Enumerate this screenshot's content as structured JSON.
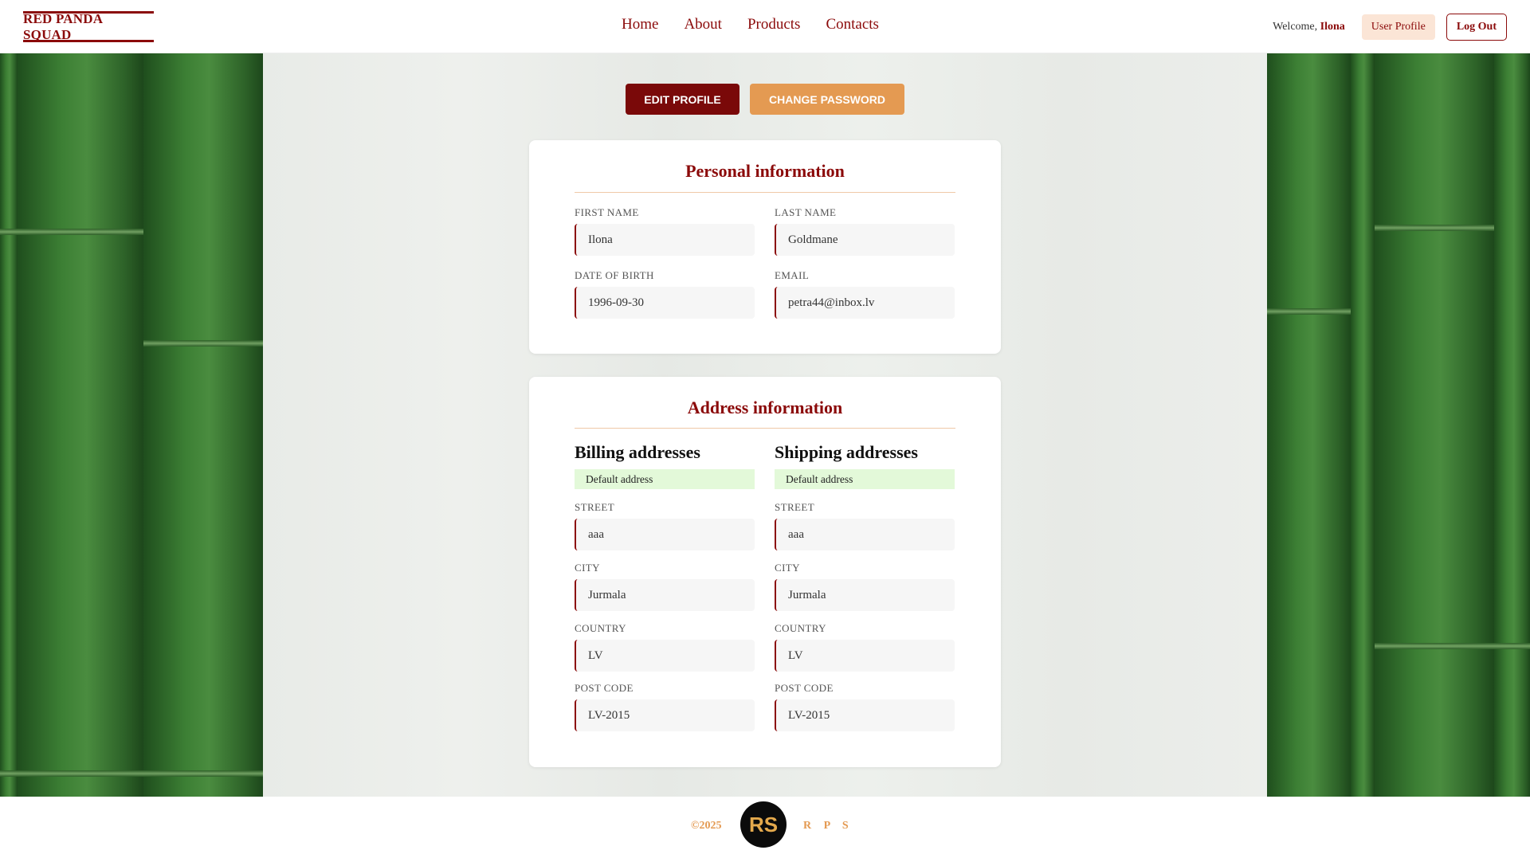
{
  "header": {
    "logo": "RED PANDA SQUAD",
    "nav": [
      "Home",
      "About",
      "Products",
      "Contacts"
    ],
    "welcome_prefix": "Welcome,",
    "user_name": "Ilona",
    "profile_label": "User Profile",
    "logout_label": "Log Out"
  },
  "actions": {
    "edit_label": "EDIT PROFILE",
    "password_label": "CHANGE PASSWORD"
  },
  "personal": {
    "title": "Personal information",
    "first_name": {
      "label": "FIRST NAME",
      "value": "Ilona"
    },
    "last_name": {
      "label": "LAST NAME",
      "value": "Goldmane"
    },
    "dob": {
      "label": "DATE OF BIRTH",
      "value": "1996-09-30"
    },
    "email": {
      "label": "EMAIL",
      "value": "petra44@inbox.lv"
    }
  },
  "address": {
    "title": "Address information",
    "billing": {
      "title": "Billing addresses",
      "badge": "Default address",
      "street": {
        "label": "STREET",
        "value": "aaa"
      },
      "city": {
        "label": "CITY",
        "value": "Jurmala"
      },
      "country": {
        "label": "COUNTRY",
        "value": "LV"
      },
      "post_code": {
        "label": "POST CODE",
        "value": "LV-2015"
      }
    },
    "shipping": {
      "title": "Shipping addresses",
      "badge": "Default address",
      "street": {
        "label": "STREET",
        "value": "aaa"
      },
      "city": {
        "label": "CITY",
        "value": "Jurmala"
      },
      "country": {
        "label": "COUNTRY",
        "value": "LV"
      },
      "post_code": {
        "label": "POST CODE",
        "value": "LV-2015"
      }
    }
  },
  "footer": {
    "copyright": "©2025",
    "logo_text": "RS",
    "rps": "R P S"
  },
  "colors": {
    "brand_red": "#8b0a0a",
    "accent_orange": "#e49a52",
    "badge_green": "#e3f9d9"
  }
}
